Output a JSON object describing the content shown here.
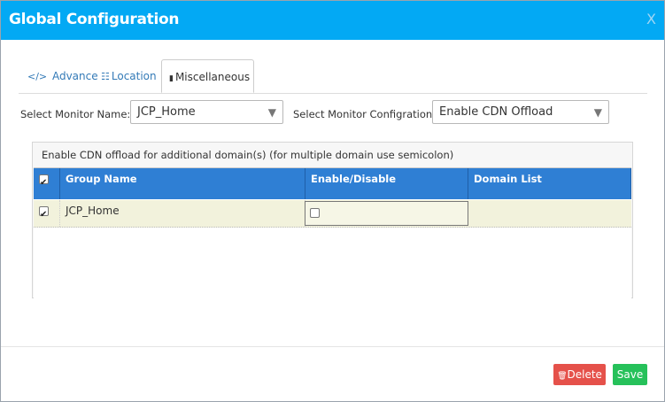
{
  "dialog": {
    "title": "Global Configuration",
    "close_glyph": "X"
  },
  "tabs": [
    {
      "label": "Advance",
      "icon": "code-icon",
      "glyph": "</>",
      "active": false
    },
    {
      "label": "Location",
      "icon": "sliders-icon",
      "glyph": "☷",
      "active": false
    },
    {
      "label": "Miscellaneous",
      "icon": "book-icon",
      "glyph": "▮",
      "active": true
    }
  ],
  "form": {
    "monitor_name_label": "Select Monitor Name:",
    "monitor_name_value": "JCP_Home",
    "monitor_config_label": "Select Monitor Configration:",
    "monitor_config_value": "Enable CDN Offload",
    "dropdown_glyph": "▼"
  },
  "panel": {
    "caption": "Enable CDN offload for additional domain(s) (for multiple domain use semicolon)"
  },
  "grid": {
    "columns": [
      "Group Name",
      "Enable/Disable",
      "Domain List"
    ],
    "header_checked": true,
    "rows": [
      {
        "checked": true,
        "group_name": "JCP_Home",
        "enabled": false,
        "domain_list": ""
      }
    ]
  },
  "buttons": {
    "delete_label": "Delete",
    "delete_glyph": "🗑",
    "save_label": "Save"
  },
  "colors": {
    "titlebar": "#03a9f4",
    "grid_header": "#2f7fd4",
    "row_highlight": "#f2f2dc",
    "delete": "#e5514a",
    "save": "#26c15a"
  }
}
